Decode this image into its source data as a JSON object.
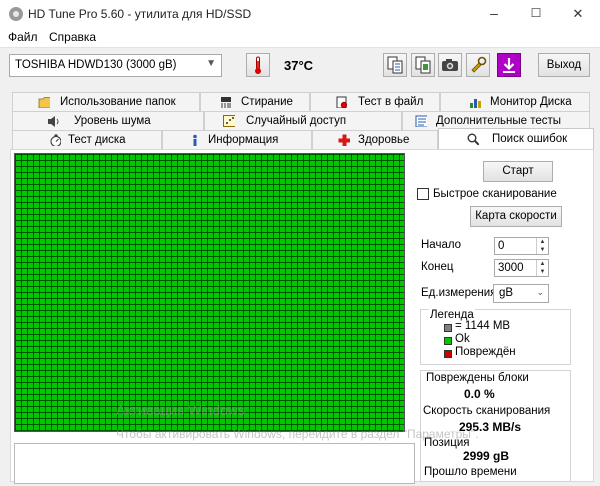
{
  "window": {
    "title": "HD Tune Pro 5.60 - утилита для HD/SSD",
    "min_glyph": "–",
    "max_glyph": "☐",
    "close_glyph": "✕"
  },
  "menu": {
    "file": "Файл",
    "help": "Справка"
  },
  "toolbar": {
    "drive": "TOSHIBA HDWD130 (3000 gB)",
    "temperature": "37°C",
    "exit_label": "Выход"
  },
  "tabs": {
    "row1": [
      "Использование папок",
      "Стирание",
      "Тест в файл",
      "Монитор Диска"
    ],
    "row2": [
      "Уровень шума",
      "Случайный доступ",
      "Дополнительные тесты"
    ],
    "row3": [
      "Тест диска",
      "Информация",
      "Здоровье",
      "Поиск ошибок"
    ]
  },
  "panel": {
    "start_label": "Старт",
    "quick_scan_label": "Быстрое сканирование",
    "speed_map_label": "Карта скорости",
    "start_field_label": "Начало",
    "start_value": "0",
    "end_field_label": "Конец",
    "end_value": "3000",
    "unit_label": "Ед.измерения",
    "unit_value": "gB"
  },
  "legend": {
    "title": "Легенда",
    "items": [
      "= 1144 MB",
      "Ok",
      "Повреждён"
    ],
    "colors": {
      "block": "#808080",
      "ok": "#00c800",
      "damaged": "#cc0000"
    }
  },
  "stats": {
    "damaged_label": "Повреждены блоки",
    "damaged_value": "0.0 %",
    "speed_label": "Скорость сканирования",
    "speed_value": "295.3 MB/s",
    "position_label": "Позиция",
    "position_value": "2999 gB",
    "elapsed_label": "Прошло времени"
  },
  "watermark": {
    "line1": "Активация Windows",
    "line2": "Чтобы активировать Windows, перейдите в раздел \"Параметры\"."
  }
}
